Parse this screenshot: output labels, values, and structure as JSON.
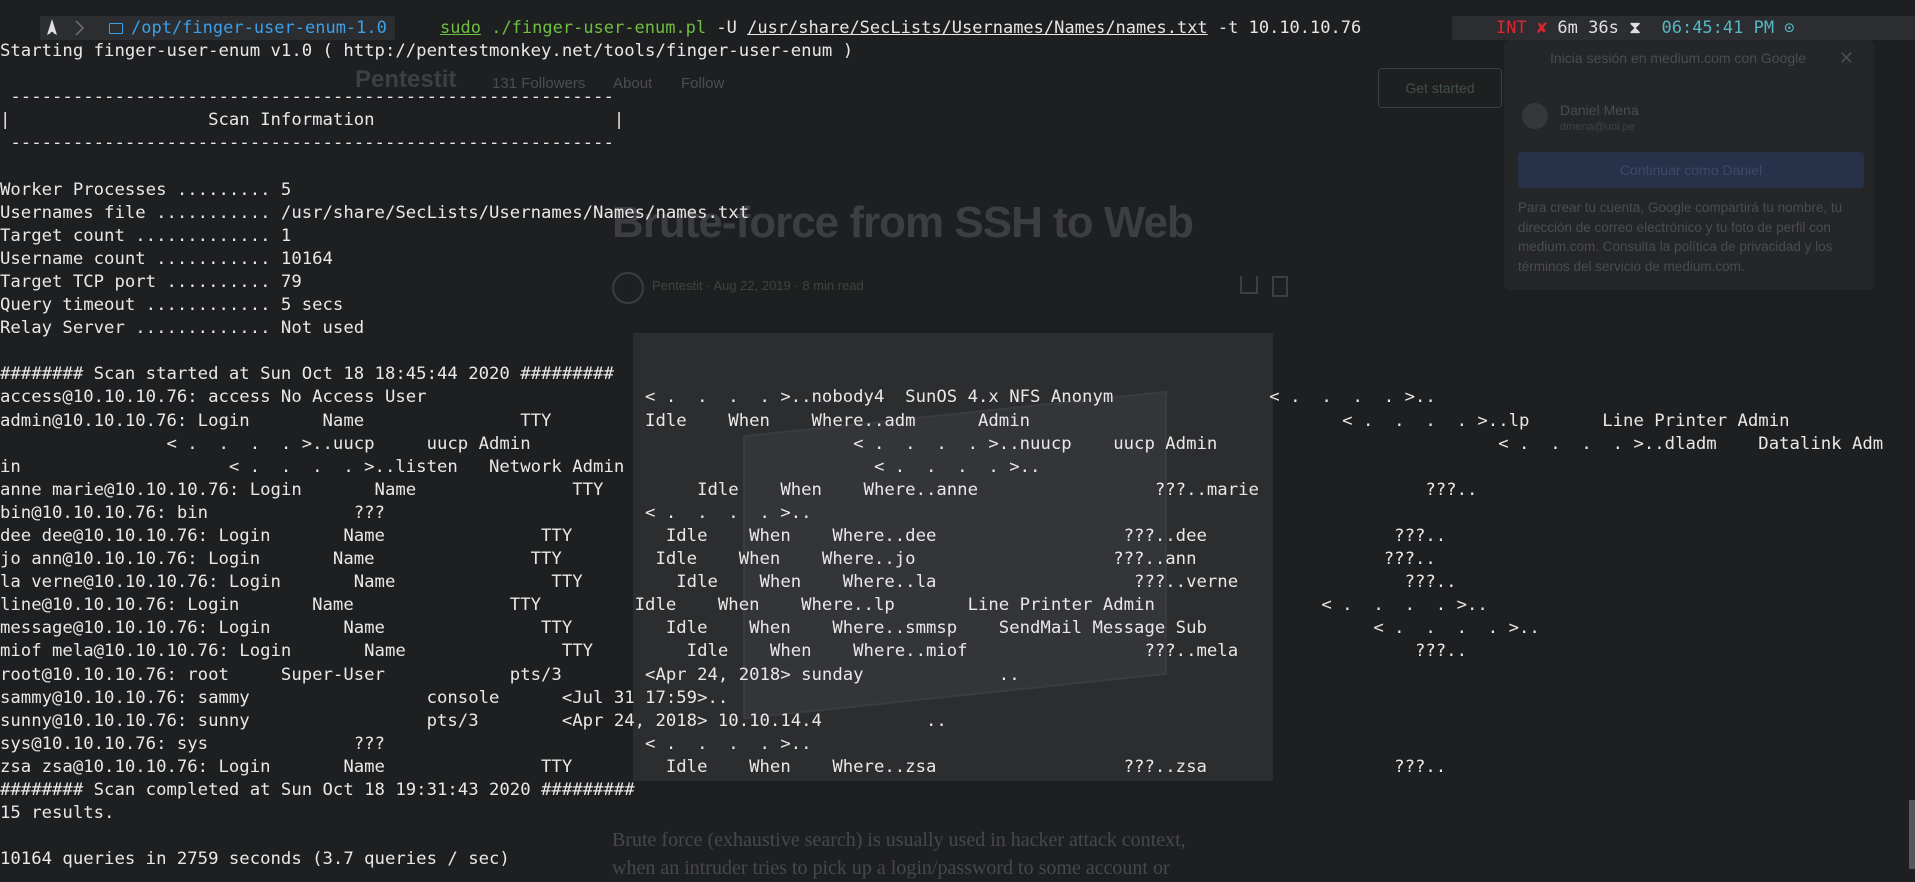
{
  "background_page": {
    "brand": "Pentestit",
    "followers": "131 Followers",
    "about": "About",
    "follow": "Follow",
    "get_started": "Get started",
    "article_title": "Brute-force from SSH to Web",
    "author_meta": "Pentestit · Aug 22, 2019 · 8 min read",
    "intro_line1": "Brute force (exhaustive search) is usually used in hacker attack context,",
    "intro_line2": "when an intruder tries to pick up a login/password to some account or",
    "google_title": "Inicia sesión en medium.com con Google",
    "google_close": "✕",
    "google_name": "Daniel Mena",
    "google_email": "dmena@uni.pe",
    "google_button": "Continuar como Daniel",
    "google_text": "Para crear tu cuenta, Google compartirá tu nombre, tu dirección de correo electrónico y tu foto de perfil con medium.com. Consulta la política de privacidad y los términos del servicio de medium.com."
  },
  "prompt": {
    "arch_icon": "arch-linux-icon",
    "dir_icon": "folder-icon",
    "directory": "/opt/finger-user-enum-1.0",
    "sudo": "sudo",
    "script": "./finger-user-enum.pl",
    "flag_u": " -U ",
    "userlist": "/usr/share/SecLists/Usernames/Names/names.txt",
    "flag_t": " -t 10.10.10.76",
    "status_int": "INT ✘",
    "status_elapsed": " 6m 36s ⧗",
    "status_clock": "  06:45:41 PM ⊙"
  },
  "terminal": {
    "lines": [
      "Starting finger-user-enum v1.0 ( http://pentestmonkey.net/tools/finger-user-enum )",
      "",
      " ----------------------------------------------------------",
      "|                   Scan Information                       |",
      " ----------------------------------------------------------",
      "",
      "Worker Processes ......... 5",
      "Usernames file ........... /usr/share/SecLists/Usernames/Names/names.txt",
      "Target count ............. 1",
      "Username count ........... 10164",
      "Target TCP port .......... 79",
      "Query timeout ............ 5 secs",
      "Relay Server ............. Not used",
      "",
      "######## Scan started at Sun Oct 18 18:45:44 2020 #########",
      "access@10.10.10.76: access No Access User                     < .  .  .  . >..nobody4  SunOS 4.x NFS Anonym               < .  .  .  . >..",
      "admin@10.10.10.76: Login       Name               TTY         Idle    When    Where..adm      Admin                              < .  .  .  . >..lp       Line Printer Admin",
      "                < .  .  .  . >..uucp     uucp Admin                               < .  .  .  . >..nuucp    uucp Admin                           < .  .  .  . >..dladm    Datalink Adm",
      "in                    < .  .  .  . >..listen   Network Admin                        < .  .  .  . >..",
      "anne marie@10.10.10.76: Login       Name               TTY         Idle    When    Where..anne                 ???..marie                ???..",
      "bin@10.10.10.76: bin              ???                         < .  .  .  . >..",
      "dee dee@10.10.10.76: Login       Name               TTY         Idle    When    Where..dee                  ???..dee                  ???..",
      "jo ann@10.10.10.76: Login       Name               TTY         Idle    When    Where..jo                   ???..ann                  ???..",
      "la verne@10.10.10.76: Login       Name               TTY         Idle    When    Where..la                   ???..verne                ???..",
      "line@10.10.10.76: Login       Name               TTY         Idle    When    Where..lp       Line Printer Admin                < .  .  .  . >..",
      "message@10.10.10.76: Login       Name               TTY         Idle    When    Where..smmsp    SendMail Message Sub                < .  .  .  . >..",
      "miof mela@10.10.10.76: Login       Name               TTY         Idle    When    Where..miof                 ???..mela                 ???..",
      "root@10.10.10.76: root     Super-User            pts/3        <Apr 24, 2018> sunday             ..",
      "sammy@10.10.10.76: sammy                 console      <Jul 31 17:59>..",
      "sunny@10.10.10.76: sunny                 pts/3        <Apr 24, 2018> 10.10.14.4          ..",
      "sys@10.10.10.76: sys              ???                         < .  .  .  . >..",
      "zsa zsa@10.10.10.76: Login       Name               TTY         Idle    When    Where..zsa                  ???..zsa                  ???..",
      "######## Scan completed at Sun Oct 18 19:31:43 2020 #########",
      "15 results.",
      "",
      "10164 queries in 2759 seconds (3.7 queries / sec)"
    ]
  }
}
